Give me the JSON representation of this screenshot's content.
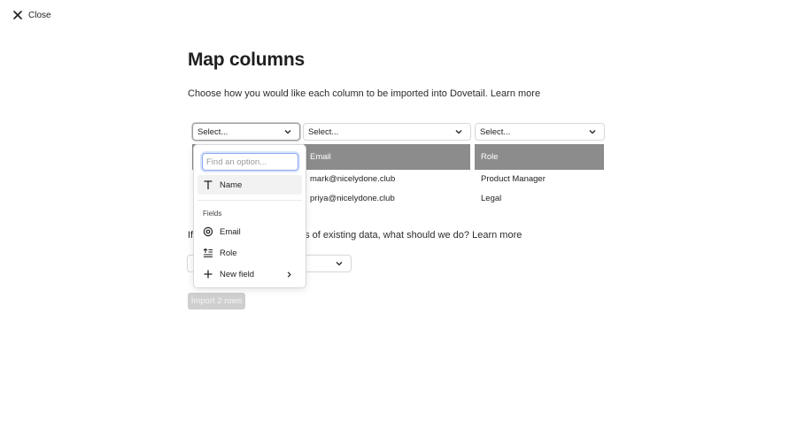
{
  "header": {
    "close_label": "Close"
  },
  "page": {
    "title": "Map columns",
    "subtitle_text": "Choose how you would like each column to be imported into Dovetail.",
    "subtitle_link": "Learn more"
  },
  "columns": [
    {
      "select_label": "Select...",
      "header": "",
      "rows": [
        "",
        ""
      ]
    },
    {
      "select_label": "Select...",
      "header": "Email",
      "rows": [
        "mark@nicelydone.club",
        "priya@nicelydone.club"
      ]
    },
    {
      "select_label": "Select...",
      "header": "Role",
      "rows": [
        "Product Manager",
        "Legal"
      ]
    }
  ],
  "duplicate": {
    "question_start": "If",
    "question_rest": "s of existing data, what should we do?",
    "link": "Learn more"
  },
  "import_button": "Import 2 rows",
  "dropdown": {
    "search_placeholder": "Find an option...",
    "top_option": "Name",
    "section_label": "Fields",
    "options": [
      "Email",
      "Role"
    ],
    "new_field": "New field"
  },
  "colors": {
    "header_bg": "#8c8c8c",
    "focus_ring": "#8aa8f0",
    "disabled_button": "#cfcfcf"
  }
}
